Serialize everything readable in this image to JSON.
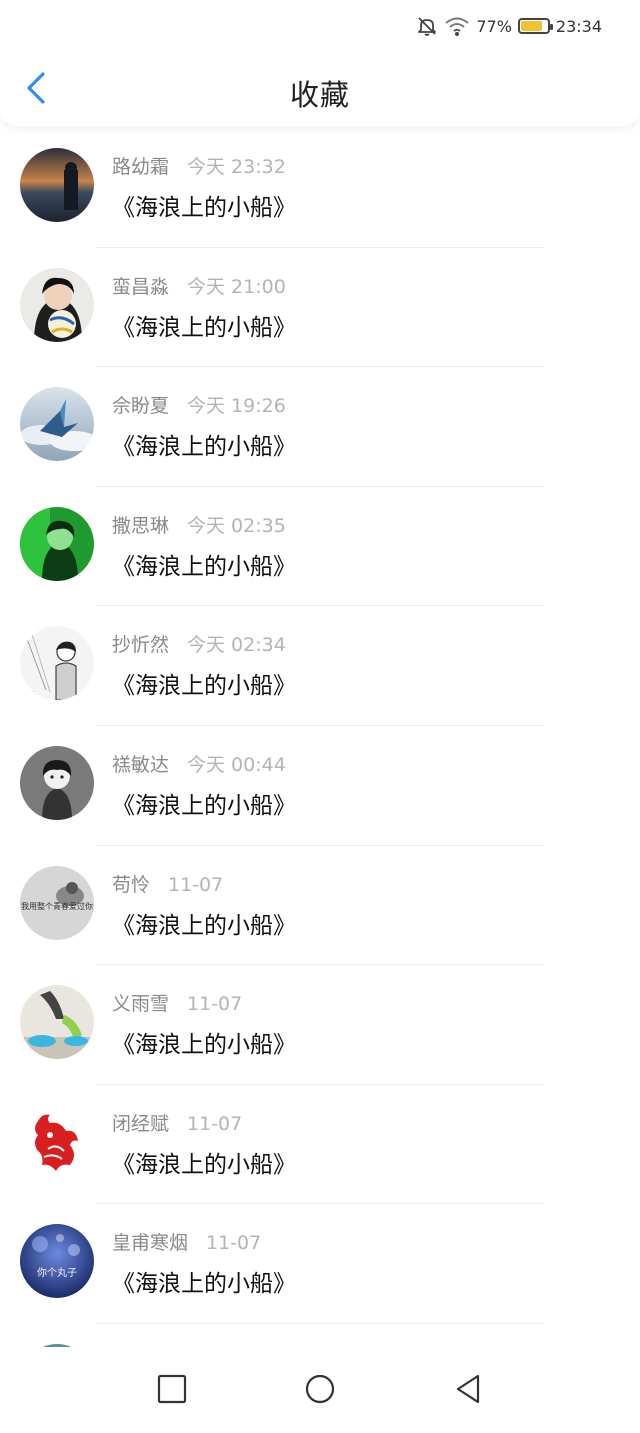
{
  "status_bar": {
    "icons": [
      "bell-off-icon",
      "wifi-icon",
      "battery-icon"
    ],
    "battery_percent": "77%",
    "battery_level": 0.77,
    "battery_color": "#f1c232",
    "time": "23:34"
  },
  "header": {
    "back_icon": "chevron-left-icon",
    "title": "收藏",
    "accent_color": "#2b8ff0"
  },
  "items": [
    {
      "name": "路幼霜",
      "time": "今天 23:32",
      "song": "《海浪上的小船》",
      "avatar": "sunset-sea"
    },
    {
      "name": "蛮昌淼",
      "time": "今天 21:00",
      "song": "《海浪上的小船》",
      "avatar": "girl-volleyball"
    },
    {
      "name": "佘盼夏",
      "time": "今天 19:26",
      "song": "《海浪上的小船》",
      "avatar": "sky-crane"
    },
    {
      "name": "撒思琳",
      "time": "今天 02:35",
      "song": "《海浪上的小船》",
      "avatar": "green-portrait"
    },
    {
      "name": "抄忻然",
      "time": "今天 02:34",
      "song": "《海浪上的小船》",
      "avatar": "bw-sketch"
    },
    {
      "name": "禚敏达",
      "time": "今天 00:44",
      "song": "《海浪上的小船》",
      "avatar": "gray-anime-boy"
    },
    {
      "name": "苟怜",
      "time": "11-07",
      "song": "《海浪上的小船》",
      "avatar": "gray-caption",
      "avatar_caption": "我用整个青春爱过你"
    },
    {
      "name": "义雨雪",
      "time": "11-07",
      "song": "《海浪上的小船》",
      "avatar": "sneakers"
    },
    {
      "name": "闭经赋",
      "time": "11-07",
      "song": "《海浪上的小船》",
      "avatar": "red-paper-cut"
    },
    {
      "name": "皇甫寒烟",
      "time": "11-07",
      "song": "《海浪上的小船》",
      "avatar": "blue-bokeh",
      "avatar_caption": "你个丸子"
    }
  ],
  "nav_bar": {
    "recents_icon": "square-icon",
    "home_icon": "circle-icon",
    "back_icon": "triangle-back-icon"
  }
}
